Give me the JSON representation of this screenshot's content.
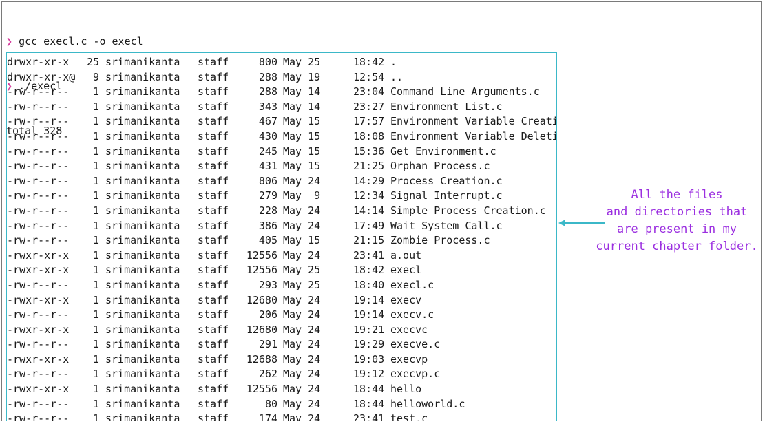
{
  "terminal": {
    "prompt_glyph": "❯",
    "commands": [
      "gcc execl.c -o execl",
      "./execl"
    ],
    "total_line": "total 328"
  },
  "listing": [
    {
      "perm": "drwxr-xr-x",
      "links": "25",
      "owner": "srimanikanta",
      "group": "staff",
      "size": "800",
      "date": "May 25",
      "time": "18:42",
      "name": "."
    },
    {
      "perm": "drwxr-xr-x@",
      "links": "9",
      "owner": "srimanikanta",
      "group": "staff",
      "size": "288",
      "date": "May 19",
      "time": "12:54",
      "name": ".."
    },
    {
      "perm": "-rw-r--r--",
      "links": "1",
      "owner": "srimanikanta",
      "group": "staff",
      "size": "288",
      "date": "May 14",
      "time": "23:04",
      "name": "Command Line Arguments.c"
    },
    {
      "perm": "-rw-r--r--",
      "links": "1",
      "owner": "srimanikanta",
      "group": "staff",
      "size": "343",
      "date": "May 14",
      "time": "23:27",
      "name": "Environment List.c"
    },
    {
      "perm": "-rw-r--r--",
      "links": "1",
      "owner": "srimanikanta",
      "group": "staff",
      "size": "467",
      "date": "May 15",
      "time": "17:57",
      "name": "Environment Variable Creation.c"
    },
    {
      "perm": "-rw-r--r--",
      "links": "1",
      "owner": "srimanikanta",
      "group": "staff",
      "size": "430",
      "date": "May 15",
      "time": "18:08",
      "name": "Environment Variable Deletion.c"
    },
    {
      "perm": "-rw-r--r--",
      "links": "1",
      "owner": "srimanikanta",
      "group": "staff",
      "size": "245",
      "date": "May 15",
      "time": "15:36",
      "name": "Get Environment.c"
    },
    {
      "perm": "-rw-r--r--",
      "links": "1",
      "owner": "srimanikanta",
      "group": "staff",
      "size": "431",
      "date": "May 15",
      "time": "21:25",
      "name": "Orphan Process.c"
    },
    {
      "perm": "-rw-r--r--",
      "links": "1",
      "owner": "srimanikanta",
      "group": "staff",
      "size": "806",
      "date": "May 24",
      "time": "14:29",
      "name": "Process Creation.c"
    },
    {
      "perm": "-rw-r--r--",
      "links": "1",
      "owner": "srimanikanta",
      "group": "staff",
      "size": "279",
      "date": "May  9",
      "time": "12:34",
      "name": "Signal Interrupt.c"
    },
    {
      "perm": "-rw-r--r--",
      "links": "1",
      "owner": "srimanikanta",
      "group": "staff",
      "size": "228",
      "date": "May 24",
      "time": "14:14",
      "name": "Simple Process Creation.c"
    },
    {
      "perm": "-rw-r--r--",
      "links": "1",
      "owner": "srimanikanta",
      "group": "staff",
      "size": "386",
      "date": "May 24",
      "time": "17:49",
      "name": "Wait System Call.c"
    },
    {
      "perm": "-rw-r--r--",
      "links": "1",
      "owner": "srimanikanta",
      "group": "staff",
      "size": "405",
      "date": "May 15",
      "time": "21:15",
      "name": "Zombie Process.c"
    },
    {
      "perm": "-rwxr-xr-x",
      "links": "1",
      "owner": "srimanikanta",
      "group": "staff",
      "size": "12556",
      "date": "May 24",
      "time": "23:41",
      "name": "a.out"
    },
    {
      "perm": "-rwxr-xr-x",
      "links": "1",
      "owner": "srimanikanta",
      "group": "staff",
      "size": "12556",
      "date": "May 25",
      "time": "18:42",
      "name": "execl"
    },
    {
      "perm": "-rw-r--r--",
      "links": "1",
      "owner": "srimanikanta",
      "group": "staff",
      "size": "293",
      "date": "May 25",
      "time": "18:40",
      "name": "execl.c"
    },
    {
      "perm": "-rwxr-xr-x",
      "links": "1",
      "owner": "srimanikanta",
      "group": "staff",
      "size": "12680",
      "date": "May 24",
      "time": "19:14",
      "name": "execv"
    },
    {
      "perm": "-rw-r--r--",
      "links": "1",
      "owner": "srimanikanta",
      "group": "staff",
      "size": "206",
      "date": "May 24",
      "time": "19:14",
      "name": "execv.c"
    },
    {
      "perm": "-rwxr-xr-x",
      "links": "1",
      "owner": "srimanikanta",
      "group": "staff",
      "size": "12680",
      "date": "May 24",
      "time": "19:21",
      "name": "execvc"
    },
    {
      "perm": "-rw-r--r--",
      "links": "1",
      "owner": "srimanikanta",
      "group": "staff",
      "size": "291",
      "date": "May 24",
      "time": "19:29",
      "name": "execve.c"
    },
    {
      "perm": "-rwxr-xr-x",
      "links": "1",
      "owner": "srimanikanta",
      "group": "staff",
      "size": "12688",
      "date": "May 24",
      "time": "19:03",
      "name": "execvp"
    },
    {
      "perm": "-rw-r--r--",
      "links": "1",
      "owner": "srimanikanta",
      "group": "staff",
      "size": "262",
      "date": "May 24",
      "time": "19:12",
      "name": "execvp.c"
    },
    {
      "perm": "-rwxr-xr-x",
      "links": "1",
      "owner": "srimanikanta",
      "group": "staff",
      "size": "12556",
      "date": "May 24",
      "time": "18:44",
      "name": "hello"
    },
    {
      "perm": "-rw-r--r--",
      "links": "1",
      "owner": "srimanikanta",
      "group": "staff",
      "size": "80",
      "date": "May 24",
      "time": "18:44",
      "name": "helloworld.c"
    },
    {
      "perm": "-rw-r--r--",
      "links": "1",
      "owner": "srimanikanta",
      "group": "staff",
      "size": "174",
      "date": "May 24",
      "time": "23:41",
      "name": "test.c"
    }
  ],
  "annotation": {
    "lines": [
      "All the files",
      "and directories that",
      "are present in my",
      "current chapter folder."
    ],
    "text_color": "#9b2fe0",
    "highlight_color": "#3bb8c8"
  }
}
